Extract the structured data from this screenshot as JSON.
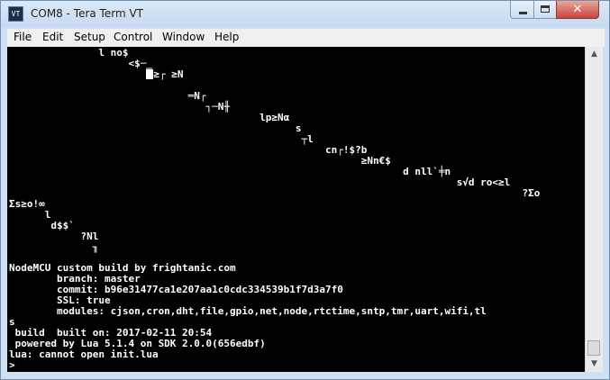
{
  "window": {
    "title": "COM8 - Tera Term VT",
    "icon_label": "VT"
  },
  "titlebar_buttons": {
    "minimize": "minimize",
    "maximize": "maximize",
    "close": "close",
    "close_glyph": "✕"
  },
  "menu": {
    "items": [
      {
        "label": "File"
      },
      {
        "label": "Edit"
      },
      {
        "label": "Setup"
      },
      {
        "label": "Control"
      },
      {
        "label": "Window"
      },
      {
        "label": "Help"
      }
    ]
  },
  "terminal": {
    "colors": {
      "background": "#000000",
      "foreground": "#ffffff"
    },
    "lines": [
      "               l no$",
      "                    <$─_",
      "                       ",
      "                              ═N┌",
      "                                 ┐─N╫",
      "                                          lp≥Nα",
      "                                                s",
      "                                                 ┬l",
      "                                                     cn┌!$?b",
      "                                                           ≥Nn€$",
      "                                                                  d nll`╪n",
      "                                                                           s√d ro<≥l",
      "                                                                                      ?Σo",
      "Σs≥o!∞",
      "      l",
      "       d$$`",
      "            ?Nl",
      "              ╖",
      "",
      "NodeMCU custom build by frightanic.com",
      "        branch: master",
      "        commit: b96e31477ca1e207aa1c0cdc334539b1f7d3a7f0",
      "        SSL: true",
      "        modules: cjson,cron,dht,file,gpio,net,node,rtctime,sntp,tmr,uart,wifi,tl",
      "s",
      " build  built on: 2017-02-11 20:54",
      " powered by Lua 5.1.4 on SDK 2.0.0(656edbf)",
      "lua: cannot open init.lua",
      ">"
    ],
    "cursor_line_2_suffix": "≥┌ ≥N"
  },
  "scrollbar": {
    "position_fraction": 0.96
  }
}
